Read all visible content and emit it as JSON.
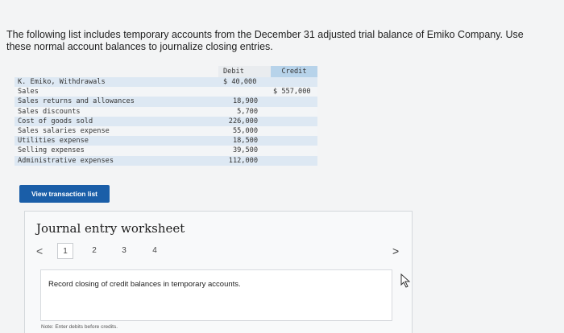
{
  "prompt_text": "The following list includes temporary accounts from the December 31 adjusted trial balance of Emiko Company. Use these normal account balances to journalize closing entries.",
  "table": {
    "debit_header": "Debit",
    "credit_header": "Credit",
    "rows": [
      {
        "name": "K. Emiko, Withdrawals",
        "debit": "$ 40,000",
        "credit": ""
      },
      {
        "name": "Sales",
        "debit": "",
        "credit": "$ 557,000"
      },
      {
        "name": "Sales returns and allowances",
        "debit": "18,900",
        "credit": ""
      },
      {
        "name": "Sales discounts",
        "debit": "5,700",
        "credit": ""
      },
      {
        "name": "Cost of goods sold",
        "debit": "226,000",
        "credit": ""
      },
      {
        "name": "Sales salaries expense",
        "debit": "55,000",
        "credit": ""
      },
      {
        "name": "Utilities expense",
        "debit": "18,500",
        "credit": ""
      },
      {
        "name": "Selling expenses",
        "debit": "39,500",
        "credit": ""
      },
      {
        "name": "Administrative expenses",
        "debit": "112,000",
        "credit": ""
      }
    ]
  },
  "view_button_label": "View transaction list",
  "worksheet": {
    "title": "Journal entry worksheet",
    "pages": [
      "1",
      "2",
      "3",
      "4"
    ],
    "active_page": "1",
    "prev_symbol": "<",
    "next_symbol": ">",
    "instruction": "Record closing of credit balances in temporary accounts.",
    "note": "Note: Enter debits before credits."
  }
}
